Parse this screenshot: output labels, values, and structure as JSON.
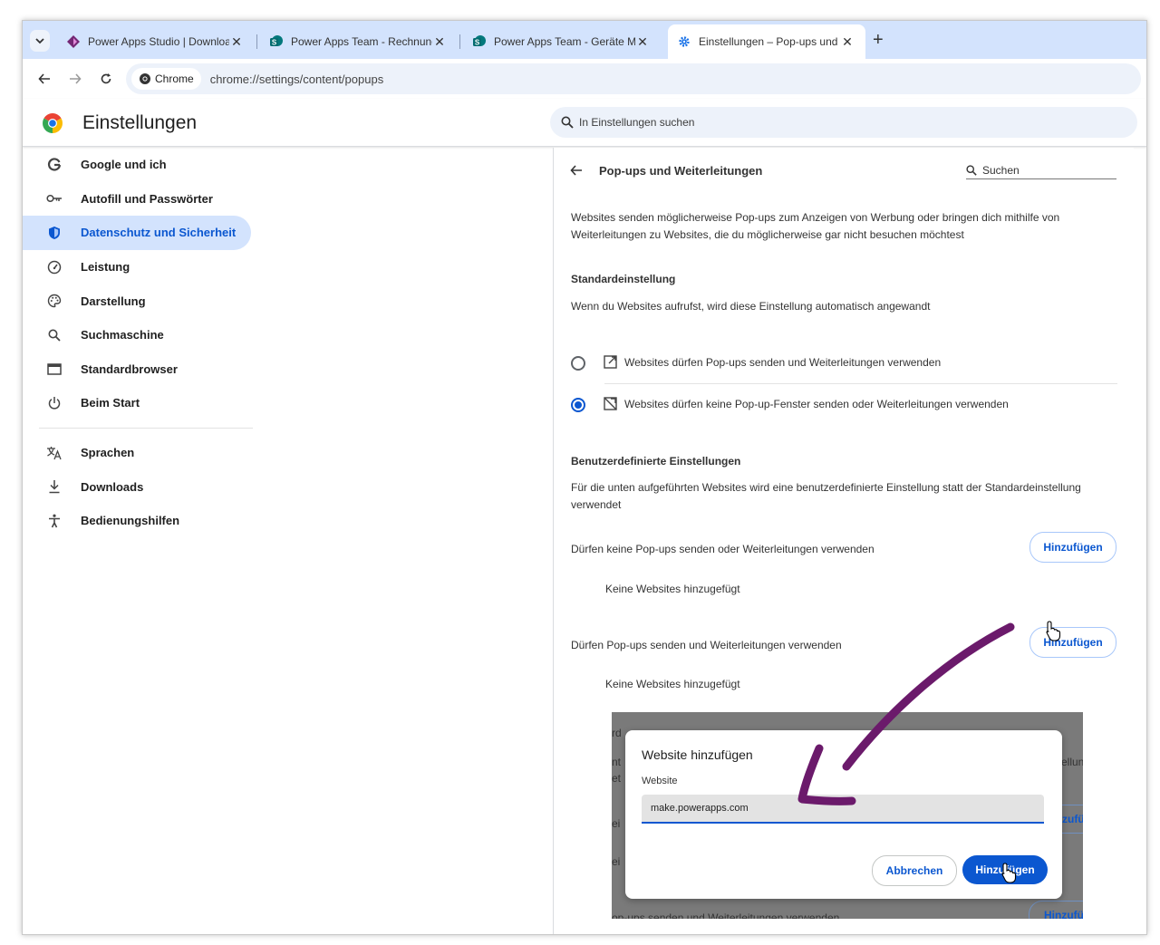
{
  "tabs": [
    {
      "title": "Power Apps Studio | Download",
      "icon": "power-apps-icon"
    },
    {
      "title": "Power Apps Team - Rechnungen",
      "icon": "sharepoint-icon"
    },
    {
      "title": "Power Apps Team - Geräte Man",
      "icon": "sharepoint-icon"
    },
    {
      "title": "Einstellungen – Pop-ups und W",
      "icon": "settings-gear-icon",
      "active": true
    }
  ],
  "toolbar": {
    "chip_label": "Chrome",
    "url": "chrome://settings/content/popups"
  },
  "header": {
    "title": "Einstellungen",
    "search_placeholder": "In Einstellungen suchen"
  },
  "sidebar": {
    "items": [
      {
        "label": "Google und ich",
        "icon": "google-g-icon"
      },
      {
        "label": "Autofill und Passwörter",
        "icon": "key-icon"
      },
      {
        "label": "Datenschutz und Sicherheit",
        "icon": "shield-icon",
        "selected": true
      },
      {
        "label": "Leistung",
        "icon": "speedometer-icon"
      },
      {
        "label": "Darstellung",
        "icon": "palette-icon"
      },
      {
        "label": "Suchmaschine",
        "icon": "search-icon"
      },
      {
        "label": "Standardbrowser",
        "icon": "browser-window-icon"
      },
      {
        "label": "Beim Start",
        "icon": "power-icon"
      },
      {
        "label": "Sprachen",
        "icon": "translate-icon"
      },
      {
        "label": "Downloads",
        "icon": "download-icon"
      },
      {
        "label": "Bedienungshilfen",
        "icon": "accessibility-icon"
      }
    ]
  },
  "content": {
    "title": "Pop-ups und Weiterleitungen",
    "search_placeholder": "Suchen",
    "description": "Websites senden möglicherweise Pop-ups zum Anzeigen von Werbung oder bringen dich mithilfe von Weiterleitungen zu Websites, die du möglicherweise gar nicht besuchen möchtest",
    "default_heading": "Standardeinstellung",
    "default_sub": "Wenn du Websites aufrufst, wird diese Einstellung automatisch angewandt",
    "option_allow": "Websites dürfen Pop-ups senden und Weiterleitungen verwenden",
    "option_block": "Websites dürfen keine Pop-up-Fenster senden oder Weiterleitungen verwenden",
    "selected_option": "block",
    "custom_heading": "Benutzerdefinierte Einstellungen",
    "custom_sub": "Für die unten aufgeführten Websites wird eine benutzerdefinierte Einstellung statt der Standardeinstellung verwendet",
    "block_list_label": "Dürfen keine Pop-ups senden oder Weiterleitungen verwenden",
    "allow_list_label": "Dürfen Pop-ups senden und Weiterleitungen verwenden",
    "add_label": "Hinzufügen",
    "empty_label": "Keine Websites hinzugefügt"
  },
  "dialog": {
    "title": "Website hinzufügen",
    "field_label": "Website",
    "field_value": "make.powerapps.com",
    "cancel_label": "Abbrechen",
    "add_label": "Hinzufügen"
  },
  "background_snippets": {
    "left_1": "rd",
    "left_2": "nt",
    "left_3": "et",
    "left_4": "ei",
    "left_5": "ei",
    "right_1": "ellun",
    "right_2": "zufü",
    "right_3": "Hinzufü",
    "bottom": "op-ups senden und Weiterleitungen verwenden"
  },
  "colors": {
    "accent": "#0b57d0",
    "tabstrip": "#d3e3fd",
    "annotation_arrow": "#6b1a6b"
  }
}
